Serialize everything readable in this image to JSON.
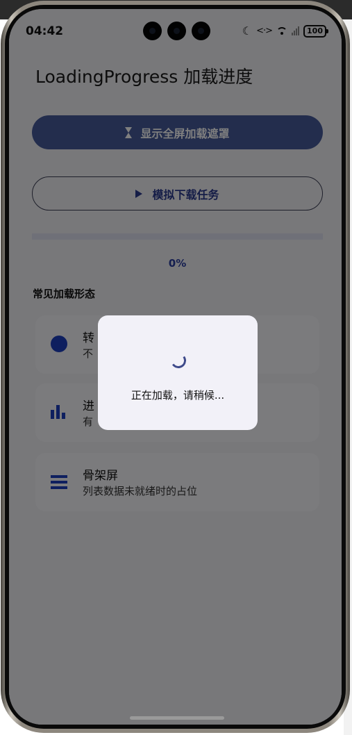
{
  "status_bar": {
    "time": "04:42",
    "battery": "100",
    "moon_icon": "moon-icon",
    "link_icon": "<·>"
  },
  "page": {
    "title": "LoadingProgress 加载进度"
  },
  "buttons": {
    "fullscreen_label": "显示全屏加载遮罩",
    "simulate_label": "模拟下载任务"
  },
  "progress": {
    "value": 0,
    "text": "0%"
  },
  "section": {
    "title": "常见加载形态"
  },
  "cards": [
    {
      "title": "转",
      "desc": "不",
      "icon": "circle-icon"
    },
    {
      "title": "进",
      "desc": "有",
      "icon": "bar-chart-icon"
    },
    {
      "title": "骨架屏",
      "desc": "列表数据未就绪时的占位",
      "icon": "list-icon"
    }
  ],
  "dialog": {
    "text": "正在加载，请稍候..."
  },
  "colors": {
    "primary": "#2b3ea0",
    "overlay": "rgba(0,0,0,0.5)"
  }
}
